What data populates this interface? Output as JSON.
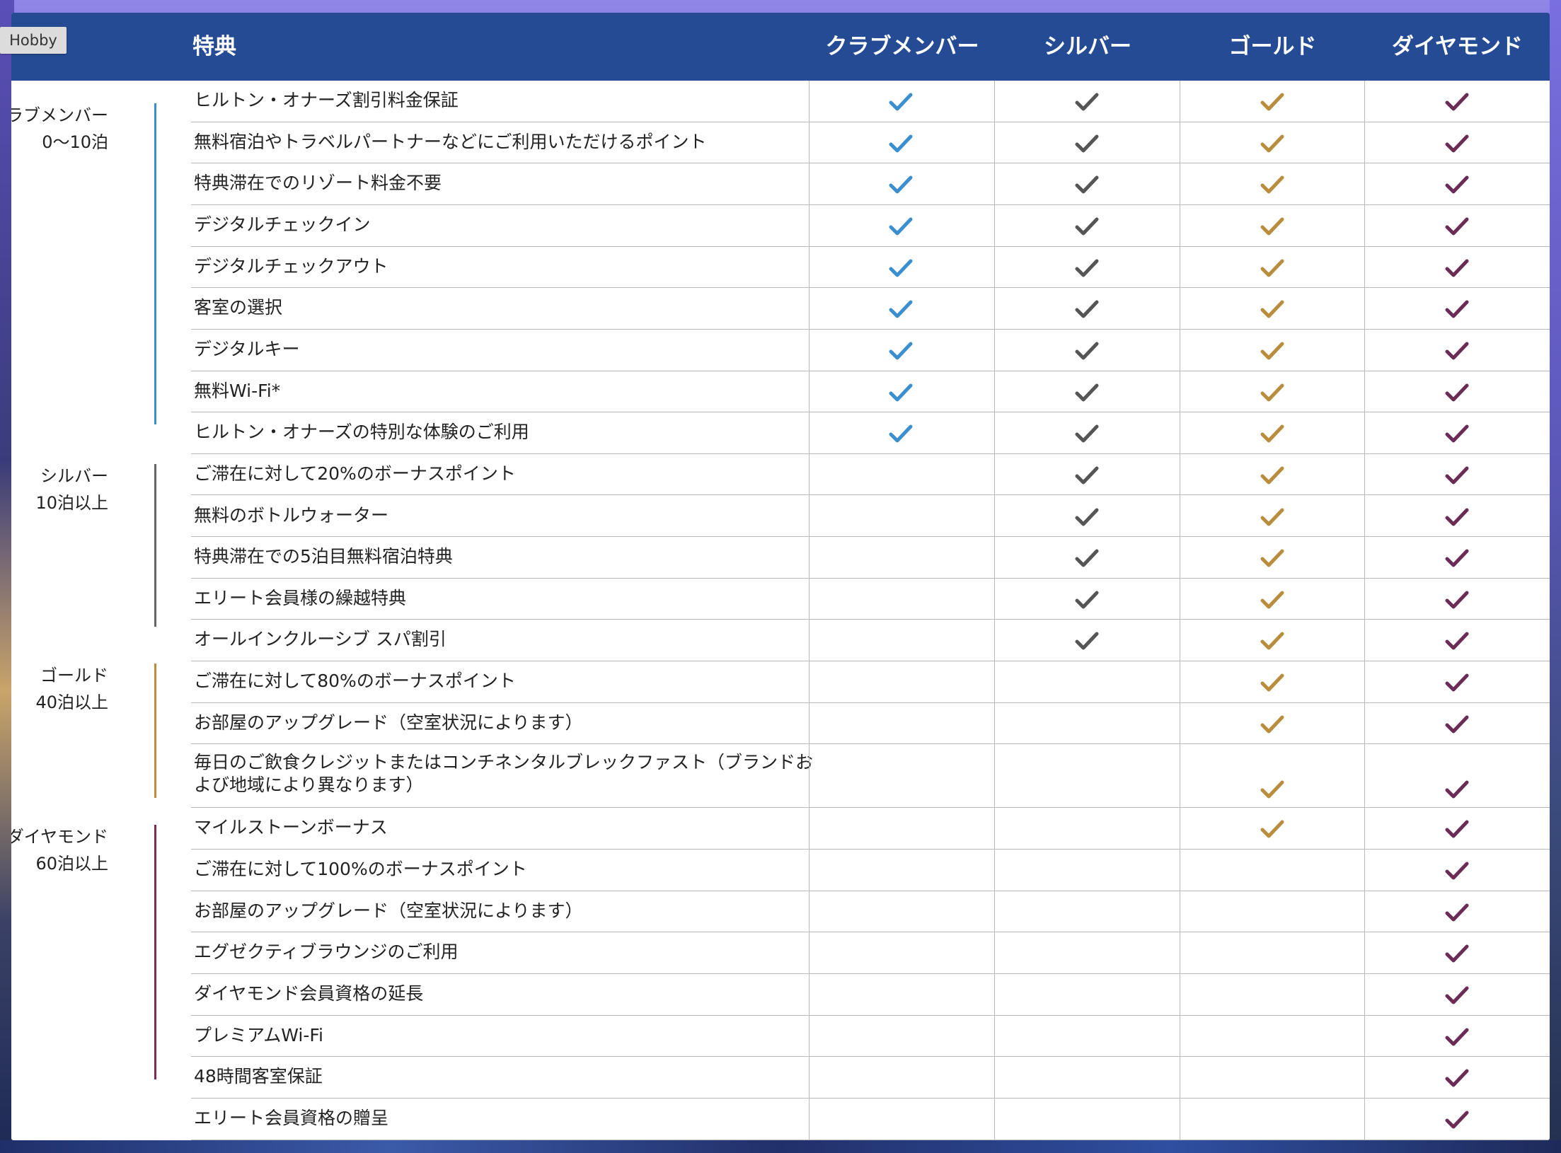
{
  "badge": "Hobby",
  "header": {
    "benefit_label": "特典",
    "tiers": [
      "クラブメンバー",
      "シルバー",
      "ゴールド",
      "ダイヤモンド"
    ]
  },
  "colors": {
    "header_bg": "#244b93",
    "member": "#3b8fd1",
    "silver": "#555555",
    "gold": "#b98d3e",
    "diamond": "#6a2c55"
  },
  "groups": [
    {
      "name": "クラブメンバー",
      "nights": "0〜10泊",
      "color": "#3b8fd1"
    },
    {
      "name": "シルバー",
      "nights": "10泊以上",
      "color": "#666666"
    },
    {
      "name": "ゴールド",
      "nights": "40泊以上",
      "color": "#b98d3e"
    },
    {
      "name": "ダイヤモンド",
      "nights": "60泊以上",
      "color": "#7a2d57"
    }
  ],
  "rows": [
    {
      "text": "ヒルトン・オナーズ割引料金保証",
      "tiers": [
        1,
        1,
        1,
        1
      ]
    },
    {
      "text": "無料宿泊やトラベルパートナーなどにご利用いただけるポイント",
      "tiers": [
        1,
        1,
        1,
        1
      ]
    },
    {
      "text": "特典滞在でのリゾート料金不要",
      "tiers": [
        1,
        1,
        1,
        1
      ]
    },
    {
      "text": "デジタルチェックイン",
      "tiers": [
        1,
        1,
        1,
        1
      ]
    },
    {
      "text": "デジタルチェックアウト",
      "tiers": [
        1,
        1,
        1,
        1
      ]
    },
    {
      "text": "客室の選択",
      "tiers": [
        1,
        1,
        1,
        1
      ]
    },
    {
      "text": "デジタルキー",
      "tiers": [
        1,
        1,
        1,
        1
      ]
    },
    {
      "text": "無料Wi-Fi*",
      "tiers": [
        1,
        1,
        1,
        1
      ]
    },
    {
      "text": "ヒルトン・オナーズの特別な体験のご利用",
      "tiers": [
        1,
        1,
        1,
        1
      ]
    },
    {
      "text": "ご滞在に対して20%のボーナスポイント",
      "tiers": [
        0,
        1,
        1,
        1
      ]
    },
    {
      "text": "無料のボトルウォーター",
      "tiers": [
        0,
        1,
        1,
        1
      ]
    },
    {
      "text": "特典滞在での5泊目無料宿泊特典",
      "tiers": [
        0,
        1,
        1,
        1
      ]
    },
    {
      "text": "エリート会員様の繰越特典",
      "tiers": [
        0,
        1,
        1,
        1
      ]
    },
    {
      "text": "オールインクルーシブ スパ割引",
      "tiers": [
        0,
        1,
        1,
        1
      ]
    },
    {
      "text": "ご滞在に対して80%のボーナスポイント",
      "tiers": [
        0,
        0,
        1,
        1
      ]
    },
    {
      "text": "お部屋のアップグレード（空室状況によります）",
      "tiers": [
        0,
        0,
        1,
        1
      ]
    },
    {
      "text": "毎日のご飲食クレジットまたはコンチネンタルブレックファスト（ブランドおよび地域により異なります）",
      "tiers": [
        0,
        0,
        1,
        1
      ]
    },
    {
      "text": "マイルストーンボーナス",
      "tiers": [
        0,
        0,
        1,
        1
      ]
    },
    {
      "text": "ご滞在に対して100%のボーナスポイント",
      "tiers": [
        0,
        0,
        0,
        1
      ]
    },
    {
      "text": "お部屋のアップグレード（空室状況によります）",
      "tiers": [
        0,
        0,
        0,
        1
      ]
    },
    {
      "text": "エグゼクティブラウンジのご利用",
      "tiers": [
        0,
        0,
        0,
        1
      ]
    },
    {
      "text": "ダイヤモンド会員資格の延長",
      "tiers": [
        0,
        0,
        0,
        1
      ]
    },
    {
      "text": "プレミアムWi-Fi",
      "tiers": [
        0,
        0,
        0,
        1
      ]
    },
    {
      "text": "48時間客室保証",
      "tiers": [
        0,
        0,
        0,
        1
      ]
    },
    {
      "text": "エリート会員資格の贈呈",
      "tiers": [
        0,
        0,
        0,
        1
      ]
    }
  ]
}
